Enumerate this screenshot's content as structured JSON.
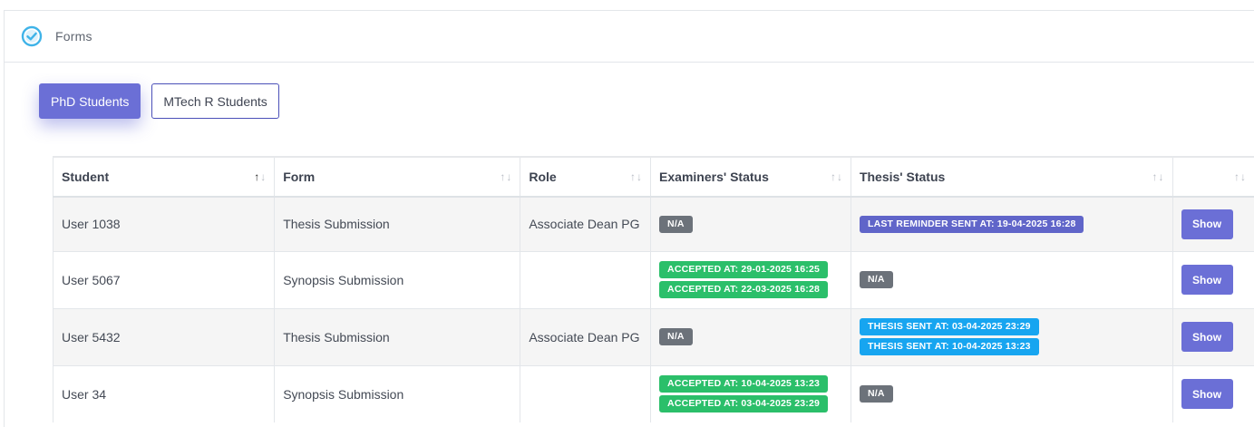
{
  "card": {
    "title": "Forms",
    "icon": "check-circle-icon"
  },
  "tabs": [
    {
      "label": "PhD Students",
      "active": true
    },
    {
      "label": "MTech R Students",
      "active": false
    }
  ],
  "table": {
    "columns": [
      "Student",
      "Form",
      "Role",
      "Examiners' Status",
      "Thesis' Status",
      ""
    ],
    "sort_glyph_up": "↑",
    "sort_glyph_down": "↓",
    "rows": [
      {
        "student": "User 1038",
        "form": "Thesis Submission",
        "role": "Associate Dean PG",
        "examiners": [
          {
            "text": "N/A",
            "kind": "na"
          }
        ],
        "thesis": [
          {
            "text": "LAST REMINDER SENT AT: 19-04-2025 16:28",
            "kind": "purple"
          }
        ],
        "action": "Show"
      },
      {
        "student": "User 5067",
        "form": "Synopsis Submission",
        "role": "",
        "examiners": [
          {
            "text": "ACCEPTED AT: 29-01-2025 16:25",
            "kind": "green"
          },
          {
            "text": "ACCEPTED AT: 22-03-2025 16:28",
            "kind": "green"
          }
        ],
        "thesis": [
          {
            "text": "N/A",
            "kind": "na"
          }
        ],
        "action": "Show"
      },
      {
        "student": "User 5432",
        "form": "Thesis Submission",
        "role": "Associate Dean PG",
        "examiners": [
          {
            "text": "N/A",
            "kind": "na"
          }
        ],
        "thesis": [
          {
            "text": "THESIS SENT AT: 03-04-2025 23:29",
            "kind": "blue"
          },
          {
            "text": "THESIS SENT AT: 10-04-2025 13:23",
            "kind": "blue"
          }
        ],
        "action": "Show"
      },
      {
        "student": "User 34",
        "form": "Synopsis Submission",
        "role": "",
        "examiners": [
          {
            "text": "ACCEPTED AT: 10-04-2025 13:23",
            "kind": "green"
          },
          {
            "text": "ACCEPTED AT: 03-04-2025 23:29",
            "kind": "green"
          }
        ],
        "thesis": [
          {
            "text": "N/A",
            "kind": "na"
          }
        ],
        "action": "Show"
      }
    ]
  },
  "colors": {
    "primary": "#6b6fd6",
    "success": "#2bbf6a",
    "info": "#17a5f0",
    "secondary": "#6c727a",
    "reminder": "#6065c9"
  }
}
